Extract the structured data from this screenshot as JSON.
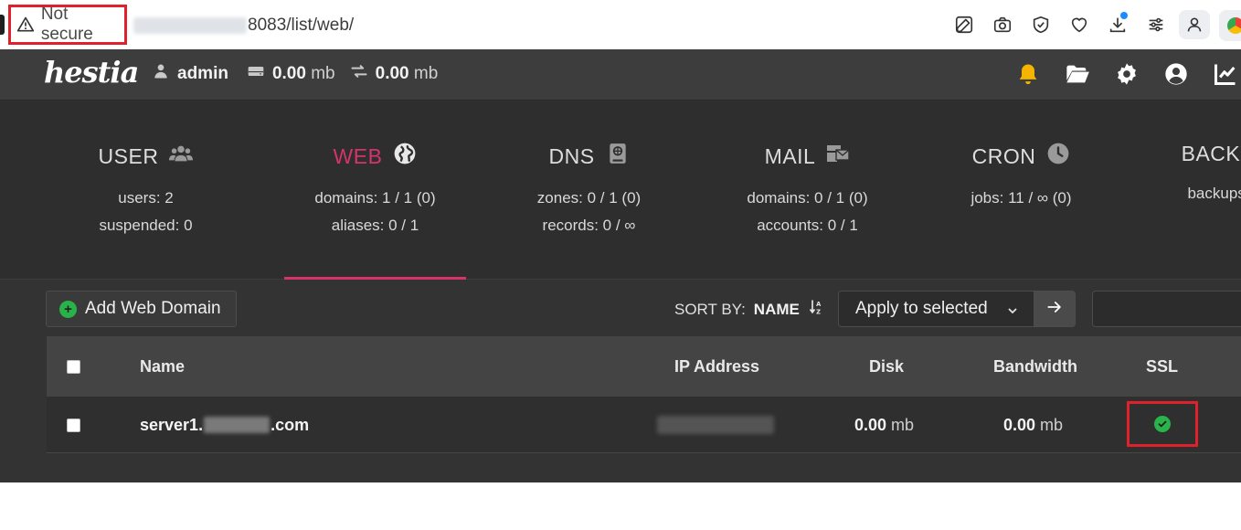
{
  "browser": {
    "security_label": "Not secure",
    "url_path": "8083/list/web/",
    "icons": [
      "edit-icon",
      "camera-icon",
      "shield-icon",
      "heart-icon",
      "download-icon",
      "sliders-icon",
      "profile-icon"
    ]
  },
  "topbar": {
    "logo": "hestia",
    "user": "admin",
    "disk_value": "0.00",
    "disk_unit": "mb",
    "bandwidth_value": "0.00",
    "bandwidth_unit": "mb",
    "icons": [
      "bell-icon",
      "folder-open-icon",
      "gear-icon",
      "user-circle-icon",
      "chart-line-icon"
    ],
    "colors": {
      "bell": "#f5b400",
      "background": "#3d3d3d"
    }
  },
  "tabs": [
    {
      "title": "USER",
      "icon": "users-icon",
      "line1": "users: 2",
      "line2": "suspended: 0"
    },
    {
      "title": "WEB",
      "icon": "globe-icon",
      "line1": "domains: 1 / 1 (0)",
      "line2": "aliases: 0 / 1",
      "active": true
    },
    {
      "title": "DNS",
      "icon": "dns-book-icon",
      "line1": "zones: 0 / 1 (0)",
      "line2": "records: 0 / ∞"
    },
    {
      "title": "MAIL",
      "icon": "mail-bulk-icon",
      "line1": "domains: 0 / 1 (0)",
      "line2": "accounts: 0 / 1"
    },
    {
      "title": "CRON",
      "icon": "clock-icon",
      "line1": "jobs: 11 / ∞ (0)",
      "line2": ""
    },
    {
      "title": "BACKU",
      "icon": "",
      "line1": "backups:",
      "line2": ""
    }
  ],
  "toolbar": {
    "add_label": "Add Web Domain",
    "sort_label": "SORT BY:",
    "sort_value": "NAME",
    "bulk_select_value": "Apply to selected"
  },
  "table": {
    "headers": {
      "name": "Name",
      "ip": "IP Address",
      "disk": "Disk",
      "bandwidth": "Bandwidth",
      "ssl": "SSL"
    },
    "rows": [
      {
        "name_prefix": "server1.",
        "name_suffix": ".com",
        "disk_value": "0.00",
        "disk_unit": "mb",
        "bandwidth_value": "0.00",
        "bandwidth_unit": "mb",
        "ssl": "enabled"
      }
    ]
  },
  "colors": {
    "accent": "#d6336c",
    "ssl_ok": "#28b34b",
    "highlight_box": "#e0202a"
  }
}
